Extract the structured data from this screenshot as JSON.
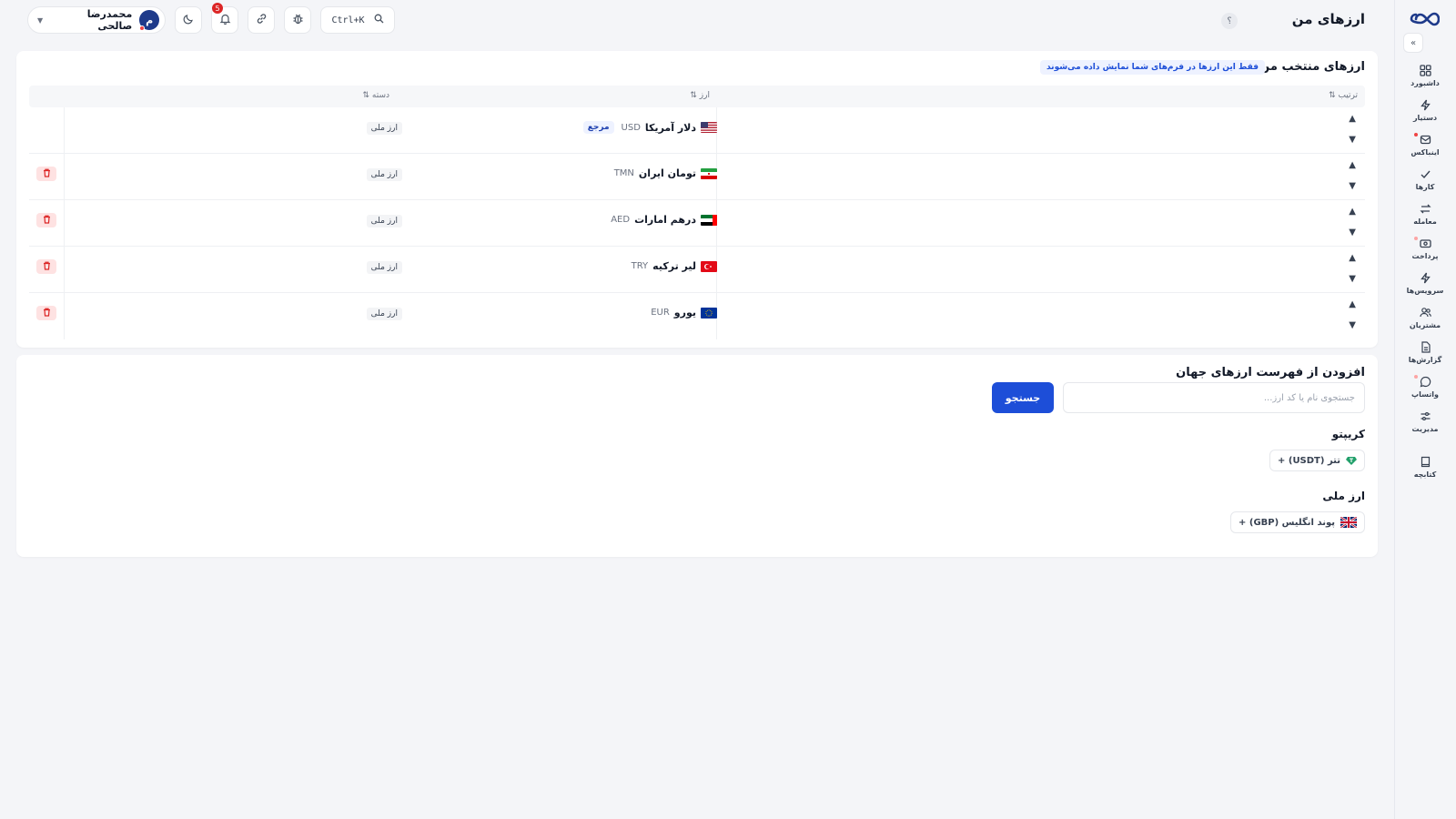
{
  "page": {
    "title": "ارزهای من",
    "help": "؟"
  },
  "topbar": {
    "search_shortcut": "Ctrl+K",
    "notifications_count": "5",
    "user": {
      "name": "محمدرضا صالحی",
      "avatar_letter": "م"
    }
  },
  "sidebar": {
    "items": [
      {
        "label": "داشبورد",
        "icon": "dashboard-icon"
      },
      {
        "label": "دستیار",
        "icon": "bolt-icon"
      },
      {
        "label": "اینباکس",
        "icon": "inbox-icon"
      },
      {
        "label": "کارها",
        "icon": "check-icon"
      },
      {
        "label": "معامله",
        "icon": "exchange-icon"
      },
      {
        "label": "پرداخت",
        "icon": "payment-icon"
      },
      {
        "label": "سرویس‌ها",
        "icon": "service-icon"
      },
      {
        "label": "مشتریان",
        "icon": "users-icon"
      },
      {
        "label": "گزارش‌ها",
        "icon": "report-icon"
      },
      {
        "label": "واتساپ",
        "icon": "chat-icon"
      },
      {
        "label": "مدیریت",
        "icon": "settings-icon"
      },
      {
        "label": "کتابچه",
        "icon": "book-icon"
      }
    ]
  },
  "selected": {
    "title": "ارزهای منتخب من",
    "hint": "فقط این ارزها در فرم‌های شما نمایش داده می‌شوند",
    "columns": {
      "order": "ترتیب ⇅",
      "currency": "ارز ⇅",
      "category": "دسته ⇅"
    },
    "rows": [
      {
        "name": "دلار آمریکا",
        "code": "USD",
        "badge": "مرجع",
        "category": "ارز ملی",
        "flag": "us"
      },
      {
        "name": "تومان ایران",
        "code": "TMN",
        "category": "ارز ملی",
        "flag": "ir"
      },
      {
        "name": "درهم امارات",
        "code": "AED",
        "category": "ارز ملی",
        "flag": "ae"
      },
      {
        "name": "لیر ترکیه",
        "code": "TRY",
        "category": "ارز ملی",
        "flag": "tr"
      },
      {
        "name": "یورو",
        "code": "EUR",
        "category": "ارز ملی",
        "flag": "eu"
      }
    ],
    "up_arrow": "▲",
    "down_arrow": "▼"
  },
  "add": {
    "title": "افزودن از فهرست ارزهای جهان",
    "search_placeholder": "جستجوی نام یا کد ارز...",
    "search_button": "جستجو",
    "crypto": {
      "title": "کریپتو",
      "items": [
        {
          "label": "تتر (USDT) +",
          "icon": "tether-icon"
        }
      ]
    },
    "fiat": {
      "title": "ارز ملی",
      "items": [
        {
          "label": "پوند انگلیس (GBP) +",
          "flag": "gb"
        }
      ]
    }
  },
  "colors": {
    "accent": "#1d4ed8",
    "danger": "#dc2626",
    "tether": "#22a06b"
  }
}
